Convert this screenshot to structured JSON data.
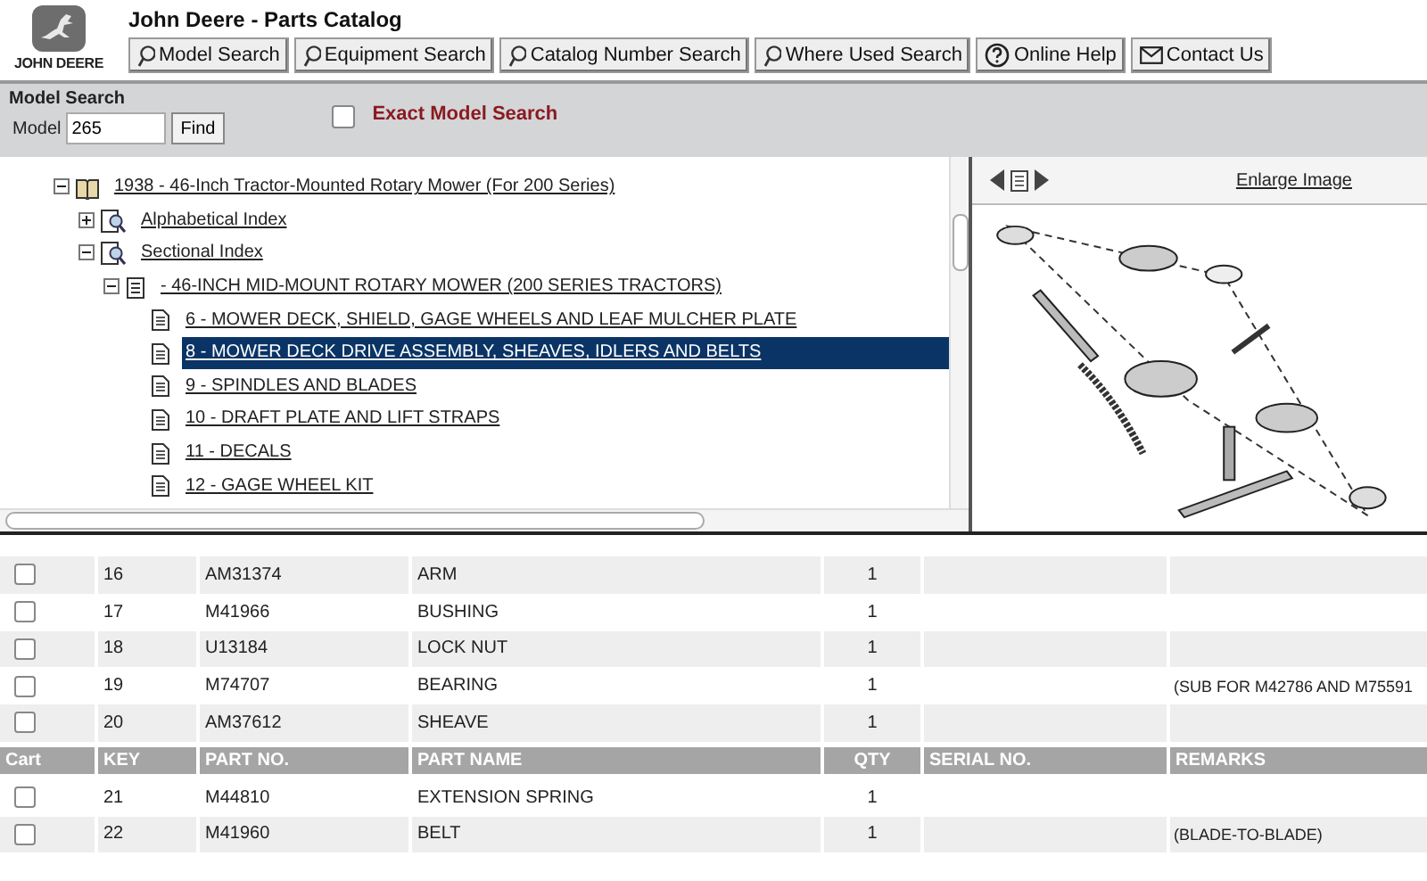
{
  "header": {
    "logo_text": "JOHN DEERE",
    "title": "John Deere - Parts Catalog",
    "buttons": [
      {
        "label": "Model Search",
        "kind": "search"
      },
      {
        "label": "Equipment Search",
        "kind": "search"
      },
      {
        "label": "Catalog Number Search",
        "kind": "search"
      },
      {
        "label": "Where Used Search",
        "kind": "search"
      },
      {
        "label": "Online Help",
        "kind": "help"
      },
      {
        "label": "Contact Us",
        "kind": "contact"
      }
    ]
  },
  "model_search": {
    "title": "Model Search",
    "field_label": "Model",
    "value": "265",
    "button": "Find",
    "exact_checked": false,
    "exact_label": "Exact Model Search"
  },
  "tree": {
    "items": [
      {
        "kind": "book",
        "label": "1938 - 46-Inch Tractor-Mounted Rotary Mower (For 200 Series)",
        "expanded": true,
        "children": [
          {
            "kind": "index",
            "label": "Alphabetical Index",
            "expanded": false
          },
          {
            "kind": "index",
            "label": "Sectional Index",
            "expanded": true,
            "children": [
              {
                "kind": "section",
                "label": " - 46-INCH MID-MOUNT ROTARY MOWER (200 SERIES TRACTORS)",
                "expanded": true,
                "children": [
                  {
                    "kind": "page",
                    "label": "6 - MOWER DECK, SHIELD, GAGE WHEELS AND LEAF MULCHER PLATE",
                    "selected": false
                  },
                  {
                    "kind": "page",
                    "label": "8 - MOWER DECK DRIVE ASSEMBLY, SHEAVES, IDLERS AND BELTS",
                    "selected": true
                  },
                  {
                    "kind": "page",
                    "label": "9 - SPINDLES AND BLADES",
                    "selected": false
                  },
                  {
                    "kind": "page",
                    "label": "10 - DRAFT PLATE AND LIFT STRAPS",
                    "selected": false
                  },
                  {
                    "kind": "page",
                    "label": "11 - DECALS",
                    "selected": false
                  },
                  {
                    "kind": "page",
                    "label": "12 - GAGE WHEEL KIT",
                    "selected": false
                  }
                ]
              }
            ]
          }
        ]
      }
    ]
  },
  "image_panel": {
    "link": "Enlarge Image"
  },
  "parts_table": {
    "rows": [
      {
        "kind": "part",
        "checked": false,
        "key": "16",
        "part_no": "AM31374",
        "part_name": "ARM",
        "qty": "1",
        "remarks": ""
      },
      {
        "kind": "part",
        "checked": false,
        "key": "17",
        "part_no": "M41966",
        "part_name": "BUSHING",
        "qty": "1",
        "remarks": ""
      },
      {
        "kind": "part",
        "checked": false,
        "key": "18",
        "part_no": "U13184",
        "part_name": "LOCK NUT",
        "qty": "1",
        "remarks": ""
      },
      {
        "kind": "part",
        "checked": false,
        "key": "19",
        "part_no": "M74707",
        "part_name": "BEARING",
        "qty": "1",
        "remarks": "(SUB FOR M42786 AND M75591"
      },
      {
        "kind": "part",
        "checked": false,
        "key": "20",
        "part_no": "AM37612",
        "part_name": "SHEAVE",
        "qty": "1",
        "remarks": ""
      },
      {
        "kind": "header",
        "cells": [
          "Cart",
          "KEY",
          "PART NO.",
          "PART NAME",
          "QTY",
          "SERIAL NO.",
          "REMARKS"
        ]
      },
      {
        "kind": "part",
        "checked": false,
        "key": "21",
        "part_no": "M44810",
        "part_name": "EXTENSION SPRING",
        "qty": "1",
        "remarks": ""
      },
      {
        "kind": "part",
        "checked": false,
        "key": "22",
        "part_no": "M41960",
        "part_name": "BELT",
        "qty": "1",
        "remarks": "(BLADE-TO-BLADE)"
      }
    ]
  }
}
